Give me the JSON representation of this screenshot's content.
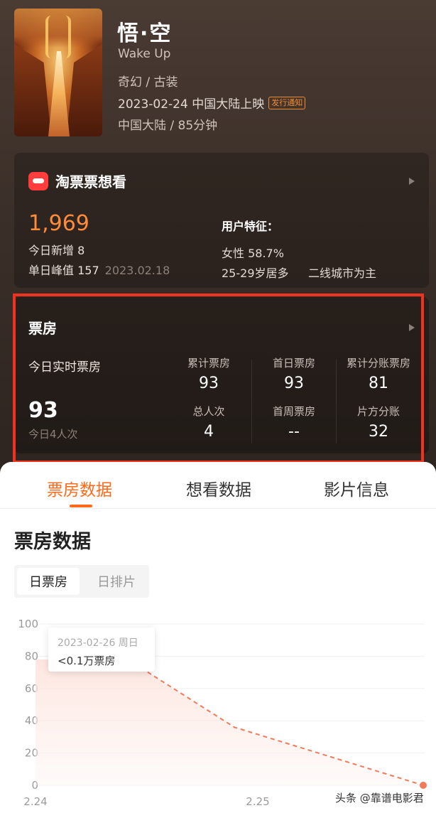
{
  "movie": {
    "title": "悟·空",
    "english_title": "Wake Up",
    "genre": "奇幻 / 古装",
    "release": "2023-02-24 中国大陆上映",
    "release_tag": "发行通知",
    "meta": "中国大陆 / 85分钟"
  },
  "want": {
    "brand": "淘票票想看",
    "count": "1,969",
    "today_new": "今日新增 8",
    "peak": "单日峰值 157",
    "peak_date": "2023.02.18",
    "features_title": "用户特征：",
    "gender": "女性 58.7%",
    "age": "25-29岁居多",
    "city": "二线城市为主"
  },
  "boxoffice": {
    "title": "票房",
    "today_label": "今日实时票房",
    "today_value": "93",
    "today_viewers": "今日4人次",
    "stats": [
      {
        "label": "累计票房",
        "value": "93"
      },
      {
        "label": "首日票房",
        "value": "93"
      },
      {
        "label": "累计分账票房",
        "value": "81"
      },
      {
        "label": "总人次",
        "value": "4"
      },
      {
        "label": "首周票房",
        "value": "--"
      },
      {
        "label": "片方分账",
        "value": "32"
      }
    ]
  },
  "tabs": [
    "票房数据",
    "想看数据",
    "影片信息"
  ],
  "section": {
    "title": "票房数据",
    "seg_on": "日票房",
    "seg_off": "日排片"
  },
  "tooltip": {
    "date": "2023-02-26 周日",
    "value": "<0.1万票房"
  },
  "chart_data": {
    "type": "line",
    "y_ticks": [
      "100",
      "80",
      "60",
      "40",
      "20",
      "0"
    ],
    "x_ticks": [
      "2.24",
      "2.25"
    ],
    "ylim": [
      0,
      100
    ],
    "series": [
      {
        "values": [
          78,
          36,
          0
        ]
      }
    ],
    "line_color": "#f07a5a"
  },
  "watermark": "头条 @靠谱电影君"
}
